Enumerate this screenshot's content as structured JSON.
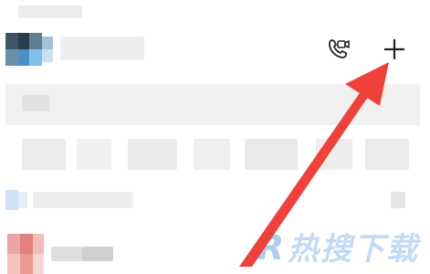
{
  "header": {
    "title": "",
    "video_call_icon": "video-call-icon",
    "add_icon": "plus-icon",
    "add_label": "+"
  },
  "watermark": {
    "letter": "R",
    "text": "热搜下载"
  },
  "colors": {
    "annotation_arrow": "#f0403a",
    "avatar_blue": "#3b78c4",
    "avatar_red": "#e88a86",
    "watermark": "#bcd6f3"
  }
}
